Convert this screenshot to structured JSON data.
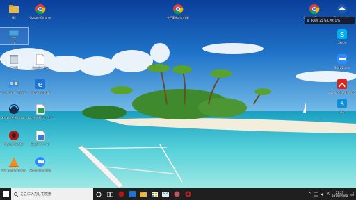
{
  "desktop": {
    "icons": [
      {
        "label": "HP"
      },
      {
        "label": "Google Chrome"
      },
      {
        "label": "今日勤務めの作業"
      },
      {
        "label": "PC"
      },
      {
        "label": "ごみ箱"
      },
      {
        "label": "Acrobat Pro"
      },
      {
        "label": "コントロール パネル"
      },
      {
        "label": "Microsoft Edge"
      },
      {
        "label": "Software Manager"
      },
      {
        "label": "Excel 作業 ファイル"
      },
      {
        "label": "Active Monitor"
      },
      {
        "label": "Excel ファイル"
      },
      {
        "label": "VLC media player"
      },
      {
        "label": "Zoom Meetings"
      },
      {
        "label": "Google Chrome"
      },
      {
        "label": "Thunderbird"
      },
      {
        "label": "Skype"
      },
      {
        "label": "Start Zoom"
      },
      {
        "label": "Acrobat Reader DC"
      },
      {
        "label": "Sky"
      }
    ]
  },
  "widget": {
    "text": "RAM: 25 %  CPU: 1 %"
  },
  "taskbar": {
    "search_placeholder": "ここに入力して検索",
    "clock_time": "21:27",
    "clock_date": "2020/05/08"
  },
  "colors": {
    "taskbar": "#1f1f1f",
    "sky_top": "#0b4fa8",
    "sea": "#3fc7d6",
    "accent": "#0078d7"
  }
}
